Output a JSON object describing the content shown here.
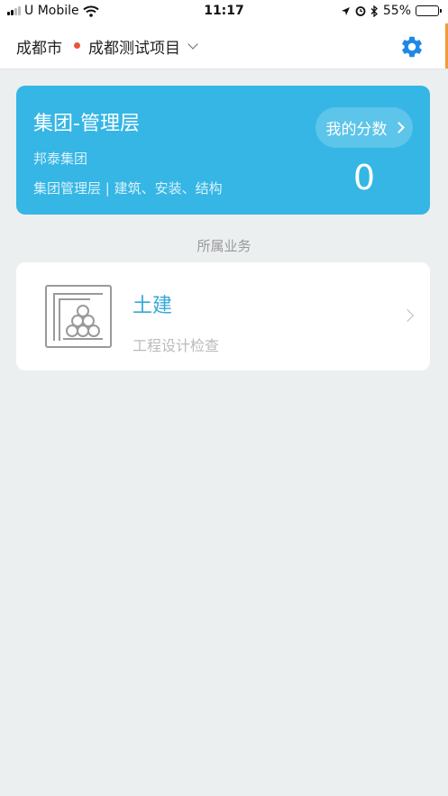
{
  "status_bar": {
    "carrier": "U Mobile",
    "time": "11:17",
    "battery_percent": "55%",
    "battery_level": 0.55,
    "icons": [
      "signal-icon",
      "wifi-icon",
      "location-icon",
      "alarm-icon",
      "bluetooth-icon",
      "battery-icon"
    ]
  },
  "nav": {
    "city": "成都市",
    "project": "成都测试项目",
    "settings_icon": "gear-icon",
    "accent_color": "#1E88E5",
    "dot_color": "#E8563A"
  },
  "profile_card": {
    "title": "集团-管理层",
    "company": "邦泰集团",
    "roles": "集团管理层 | 建筑、安装、结构",
    "score_button_label": "我的分数",
    "score": "0",
    "color": "#35B6E5"
  },
  "section_label": "所属业务",
  "business": {
    "title": "土建",
    "subtitle": "工程设计检查",
    "icon": "pipe-stack-icon"
  }
}
